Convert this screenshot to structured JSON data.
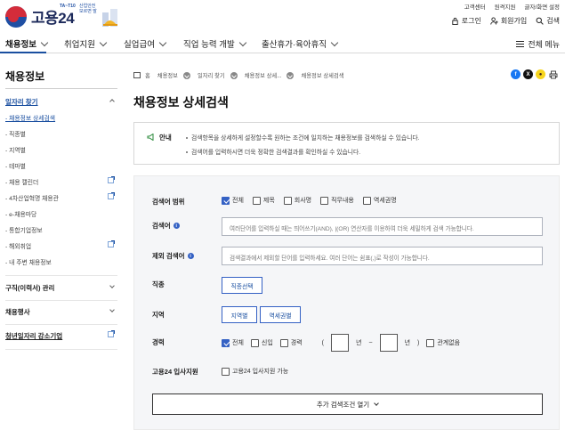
{
  "header": {
    "logo_text": "고용24",
    "badge_line1": "TA~T10",
    "badge_line2": "산업안전 모르면 말",
    "util_links": [
      "고객센터",
      "원격지원",
      "글자/화면 설정"
    ],
    "login": "로그인",
    "signup": "회원가입",
    "search": "검색"
  },
  "gnb": {
    "items": [
      "채용정보",
      "취업지원",
      "실업급여",
      "직업 능력 개발",
      "출산휴가·육아휴직"
    ],
    "all_menu": "전체 메뉴"
  },
  "sidebar": {
    "title": "채용정보",
    "sections": [
      {
        "label": "일자리 찾기",
        "open": true,
        "items": [
          {
            "label": "- 채용정보 상세검색",
            "current": true,
            "external": false
          },
          {
            "label": "- 직종별",
            "current": false,
            "external": false
          },
          {
            "label": "- 지역별",
            "current": false,
            "external": false
          },
          {
            "label": "- 테마별",
            "current": false,
            "external": false
          },
          {
            "label": "- 채용 캘린더",
            "current": false,
            "external": true
          },
          {
            "label": "- 4차산업혁명 채용관",
            "current": false,
            "external": true
          },
          {
            "label": "- e-채용마당",
            "current": false,
            "external": false
          },
          {
            "label": "- 통합기업정보",
            "current": false,
            "external": false
          },
          {
            "label": "- 해외취업",
            "current": false,
            "external": true
          },
          {
            "label": "- 내 주변 채용정보",
            "current": false,
            "external": false
          }
        ]
      },
      {
        "label": "구직(이력서) 관리",
        "open": false
      },
      {
        "label": "채용행사",
        "open": false
      },
      {
        "label": "청년일자리 강소기업",
        "open": false,
        "external": true
      }
    ]
  },
  "breadcrumb": [
    "홈",
    "채용정보",
    "일자리 찾기",
    "채용정보 상세...",
    "채용정보 상세검색"
  ],
  "page_title": "채용정보 상세검색",
  "notice": {
    "label": "안내",
    "lines": [
      "검색항목을 상세하게 설정할수록 원하는 조건에 일치하는 채용정보를 검색하실 수 있습니다.",
      "검색어를 입력하시면 더욱 정확한 검색결과를 확인하실 수 있습니다."
    ]
  },
  "form": {
    "scope": {
      "label": "검색어 범위",
      "options": [
        {
          "label": "전체",
          "checked": true
        },
        {
          "label": "제목",
          "checked": false
        },
        {
          "label": "회사명",
          "checked": false
        },
        {
          "label": "직무내용",
          "checked": false
        },
        {
          "label": "역세권명",
          "checked": false
        }
      ]
    },
    "keyword": {
      "label": "검색어",
      "placeholder": "여러단어를 입력하실 때는 띄어쓰기(AND), |(OR) 연산자를 이용하여 더욱 세밀하게 검색 가능합니다."
    },
    "exclude": {
      "label": "제외 검색어",
      "placeholder": "검색결과에서 제외할 단어를 입력하세요. 여러 단어는 쉼표(,)로 작성이 가능합니다."
    },
    "job": {
      "label": "직종",
      "button": "직종선택"
    },
    "region": {
      "label": "지역",
      "buttons": [
        "지역별",
        "역세권별"
      ]
    },
    "career": {
      "label": "경력",
      "options": [
        {
          "label": "전체",
          "checked": true
        },
        {
          "label": "신입",
          "checked": false
        },
        {
          "label": "경력",
          "checked": false
        }
      ],
      "year_unit": "년",
      "range_sep": "~",
      "open_paren": "(",
      "close_paren": ")",
      "no_matter": "관계없음"
    },
    "goyong": {
      "label": "고용24 입사지원",
      "option": "고용24 입사지원 가능"
    },
    "more_button": "추가 검색조건 열기"
  },
  "colors": {
    "accent": "#3461c4",
    "brand_navy": "#1d2a5b",
    "bg_form": "#f5f6f8"
  }
}
